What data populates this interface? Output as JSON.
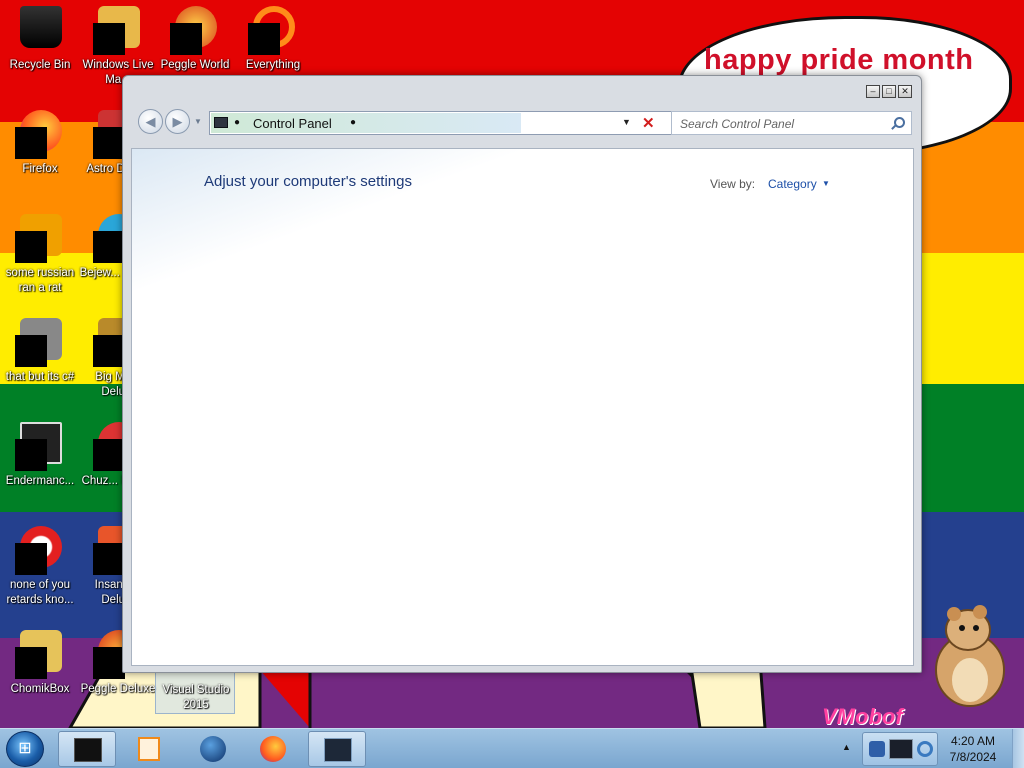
{
  "wallpaper": {
    "bubble_text": "happy pride month",
    "watermark": "VMobof"
  },
  "desktop_icons": [
    {
      "label": "Recycle Bin",
      "icon": "recycle-bin-icon"
    },
    {
      "label": "Windows Live Ma...",
      "icon": "windows-live-messenger-icon"
    },
    {
      "label": "Peggle World",
      "icon": "peggle-world-icon"
    },
    {
      "label": "Everything",
      "icon": "everything-search-icon"
    },
    {
      "label": "Firefox",
      "icon": "firefox-icon"
    },
    {
      "label": "Astro Delu...",
      "icon": "astropop-deluxe-icon"
    },
    {
      "label": "some russian ran a rat",
      "icon": "file-icon"
    },
    {
      "label": "Bejew... Delu...",
      "icon": "bejeweled-deluxe-icon"
    },
    {
      "label": "that but its c#",
      "icon": "shortcut-icon"
    },
    {
      "label": "Big Mo... Delu...",
      "icon": "big-money-deluxe-icon"
    },
    {
      "label": "Endermanc...",
      "icon": "endermanch-icon"
    },
    {
      "label": "Chuz... Delu...",
      "icon": "chuzzle-deluxe-icon"
    },
    {
      "label": "none of you retards kno...",
      "icon": "opera-icon"
    },
    {
      "label": "Insaniq... Delu...",
      "icon": "insaniquarium-deluxe-icon"
    },
    {
      "label": "ChomikBox",
      "icon": "chomikbox-icon"
    },
    {
      "label": "Peggle Deluxe",
      "icon": "peggle-deluxe-icon"
    },
    {
      "label": "Visual Studio 2015",
      "icon": "visual-studio-icon"
    }
  ],
  "window": {
    "address_text": "Control Panel",
    "search_placeholder": "Search Control Panel",
    "heading": "Adjust your computer's settings",
    "view_by_label": "View by:",
    "view_by_value": "Category"
  },
  "taskbar": {
    "clock_time": "4:20 AM",
    "clock_date": "7/8/2024",
    "items": [
      "terminal-app",
      "media-player",
      "earth-browser",
      "firefox",
      "control-panel"
    ]
  }
}
